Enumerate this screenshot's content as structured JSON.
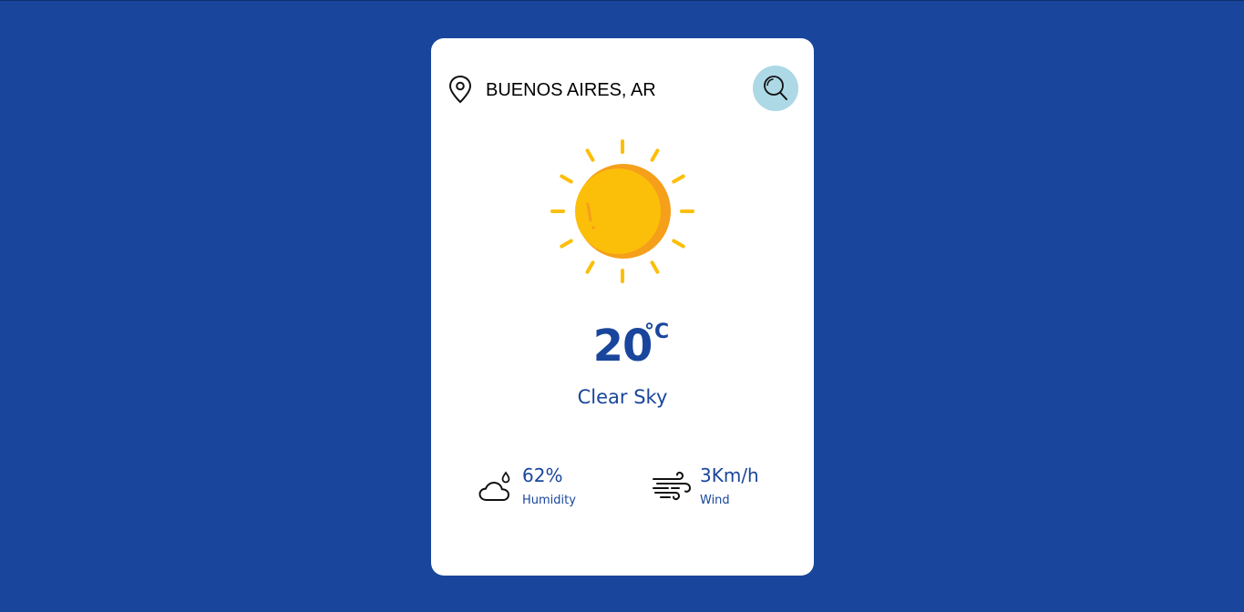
{
  "search": {
    "value": "BUENOS AIRES, AR",
    "placeholder": ""
  },
  "weather": {
    "temperature": "20",
    "unit": "°C",
    "description": "Clear Sky",
    "icon": "sun-icon"
  },
  "details": {
    "humidity": {
      "value": "62%",
      "label": "Humidity",
      "icon": "humidity-icon"
    },
    "wind": {
      "value": "3Km/h",
      "label": "Wind",
      "icon": "wind-icon"
    }
  },
  "colors": {
    "background": "#19469c",
    "card": "#ffffff",
    "accent": "#19469c",
    "search_button": "#add8e6",
    "sun": "#fbbf0a",
    "sun_shade": "#f59f1a"
  }
}
